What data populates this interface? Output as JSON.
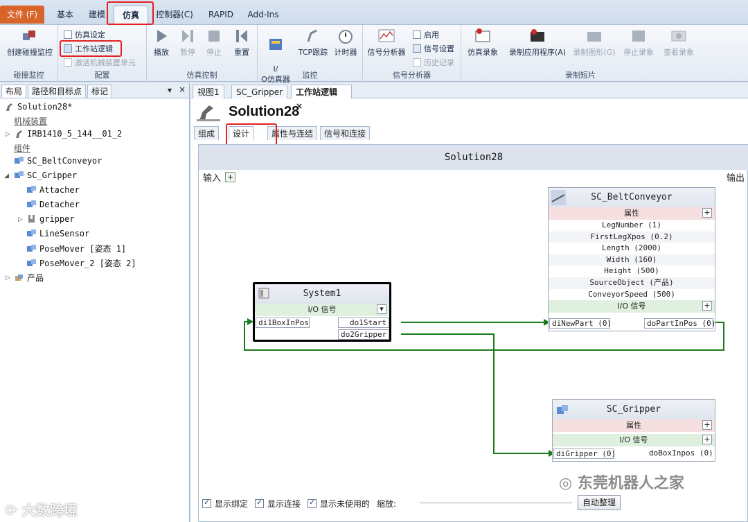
{
  "ribbon_tabs": [
    "文件 (F)",
    "基本",
    "建模",
    "仿真",
    "控制器(C)",
    "RAPID",
    "Add-Ins"
  ],
  "ribbon": {
    "groups": [
      "碰撞监控",
      "配置",
      "仿真控制",
      "监控",
      "信号分析器",
      "录制短片"
    ],
    "create_collision": "创建碰撞监控",
    "sim_setup": "仿真设定",
    "station_logic": "工作站逻辑",
    "activate_mech": "激活机械装置单元",
    "play": "播放",
    "pause": "暂停",
    "stop": "停止",
    "reset": "重置",
    "io_sim": "I/\nO仿真器",
    "tcp_trace": "TCP跟踪",
    "timer": "计时器",
    "signal_analyzer": "信号分析器",
    "enable": "启用",
    "signal_setup": "信号设置",
    "history": "历史记录",
    "sim_record": "仿真录象",
    "record_app": "录制应用程序(A)",
    "record_graphic": "录制图形(G)",
    "stop_record": "停止录象",
    "view_record": "查看录象"
  },
  "left_panel": {
    "tabs": [
      "布局",
      "路径和目标点",
      "标记"
    ],
    "pin": "▾",
    "close": "×",
    "tree": {
      "root": "Solution28*",
      "mech_header": "机械装置",
      "robot": "IRB1410_5_144__01_2",
      "comp_header": "组件",
      "conveyor": "SC_BeltConveyor",
      "gripper": "SC_Gripper",
      "children": [
        "Attacher",
        "Detacher",
        "gripper",
        "LineSensor",
        "PoseMover [姿态 1]",
        "PoseMover_2 [姿态 2]"
      ],
      "product": "产品"
    }
  },
  "doc": {
    "tabs": [
      "视图1",
      "SC_Gripper",
      "工作站逻辑"
    ],
    "tab_close": "×",
    "title": "Solution28",
    "subtabs": [
      "组成",
      "设计",
      "属性与连结",
      "信号和连接"
    ],
    "canvas_title": "Solution28",
    "input_label": "输入",
    "output_label": "输出",
    "plus": "+"
  },
  "blocks": {
    "system": {
      "name": "System1",
      "io": "I/O 信号",
      "in_sig": "di1BoxInPos",
      "out1": "do1Start",
      "out2": "do2Gripper",
      "dropdown": "▾"
    },
    "conveyor": {
      "name": "SC_BeltConveyor",
      "props_label": "属性",
      "props": [
        "LegNumber (1)",
        "FirstLegXpos (0.2)",
        "Length (2000)",
        "Width (160)",
        "Height (500)",
        "SourceObject (产品)",
        "ConveyorSpeed (500)"
      ],
      "io": "I/O 信号",
      "in_sig": "diNewPart (0)",
      "out_sig": "doPartInPos (0)"
    },
    "gripper": {
      "name": "SC_Gripper",
      "props_label": "属性",
      "io": "I/O 信号",
      "in_sig": "diGripper (0)",
      "out_sig": "doBoxInpos (0)"
    }
  },
  "bottom": {
    "show_binding": "显示绑定",
    "show_conn": "显示连接",
    "show_unused": "显示未使用的",
    "zoom": "缩放:",
    "auto_arrange": "自动整理"
  },
  "watermarks": {
    "left": "大数跨境",
    "right": "东莞机器人之家"
  },
  "colors": {
    "highlight": "#e32020",
    "wire": "#1b7a1b",
    "file_tab": "#d9642a"
  }
}
